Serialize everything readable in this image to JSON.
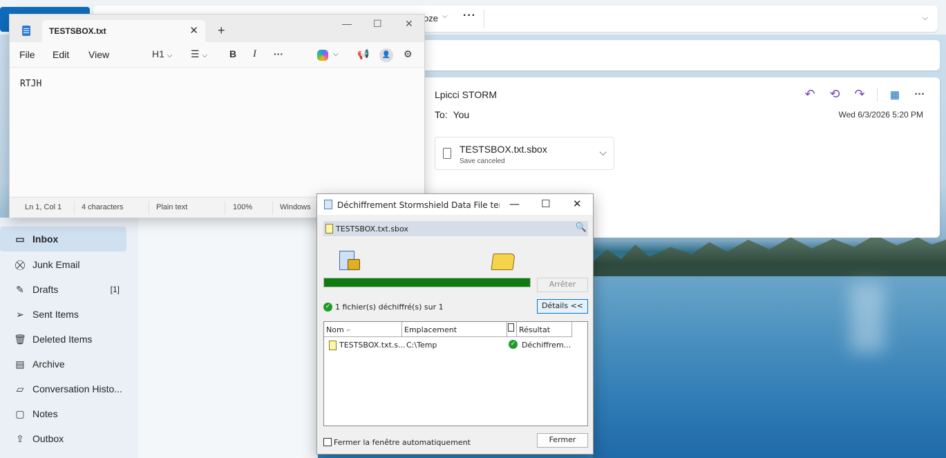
{
  "outlook": {
    "ribbon": {
      "snooze_label": "oze",
      "more_label": "···"
    },
    "reading": {
      "sender": "Lpicci STORM",
      "to_label": "To:",
      "to_value": "You",
      "date": "Wed 6/3/2026 5:20 PM",
      "attachment": {
        "name": "TESTSBOX.txt.sbox",
        "status": "Save canceled"
      }
    },
    "folders": [
      {
        "label": "Inbox",
        "icon": "inbox-icon",
        "count": ""
      },
      {
        "label": "Junk Email",
        "icon": "junk-icon",
        "count": ""
      },
      {
        "label": "Drafts",
        "icon": "drafts-icon",
        "count": "[1]"
      },
      {
        "label": "Sent Items",
        "icon": "send-icon",
        "count": ""
      },
      {
        "label": "Deleted Items",
        "icon": "trash-icon",
        "count": ""
      },
      {
        "label": "Archive",
        "icon": "archive-icon",
        "count": ""
      },
      {
        "label": "Conversation Histo...",
        "icon": "folder-icon",
        "count": ""
      },
      {
        "label": "Notes",
        "icon": "notes-icon",
        "count": ""
      },
      {
        "label": "Outbox",
        "icon": "outbox-icon",
        "count": ""
      }
    ]
  },
  "notepad": {
    "tab_title": "TESTSBOX.txt",
    "menus": [
      "File",
      "Edit",
      "View"
    ],
    "heading_tool": "H1",
    "content": "RTJH",
    "status": {
      "position": "Ln 1, Col 1",
      "chars": "4 characters",
      "format": "Plain text",
      "zoom": "100%",
      "eol": "Windows"
    }
  },
  "sds": {
    "title": "Déchiffrement Stormshield Data File termi...",
    "file": "TESTSBOX.txt.sbox",
    "progress": 100,
    "stop_label": "Arrêter",
    "result_text": "1 fichier(s) déchiffré(s) sur 1",
    "details_label": "Détails <<",
    "columns": [
      "Nom",
      "Emplacement",
      "Résultat"
    ],
    "rows": [
      {
        "name": "TESTSBOX.txt.s...",
        "location": "C:\\Temp",
        "result": "Déchiffrem..."
      }
    ],
    "autoclose_label": "Fermer la fenêtre automatiquement",
    "close_label": "Fermer"
  },
  "colors": {
    "accent": "#0f6cbd",
    "progress": "#0f7b0f",
    "reply": "#7a46b8"
  }
}
